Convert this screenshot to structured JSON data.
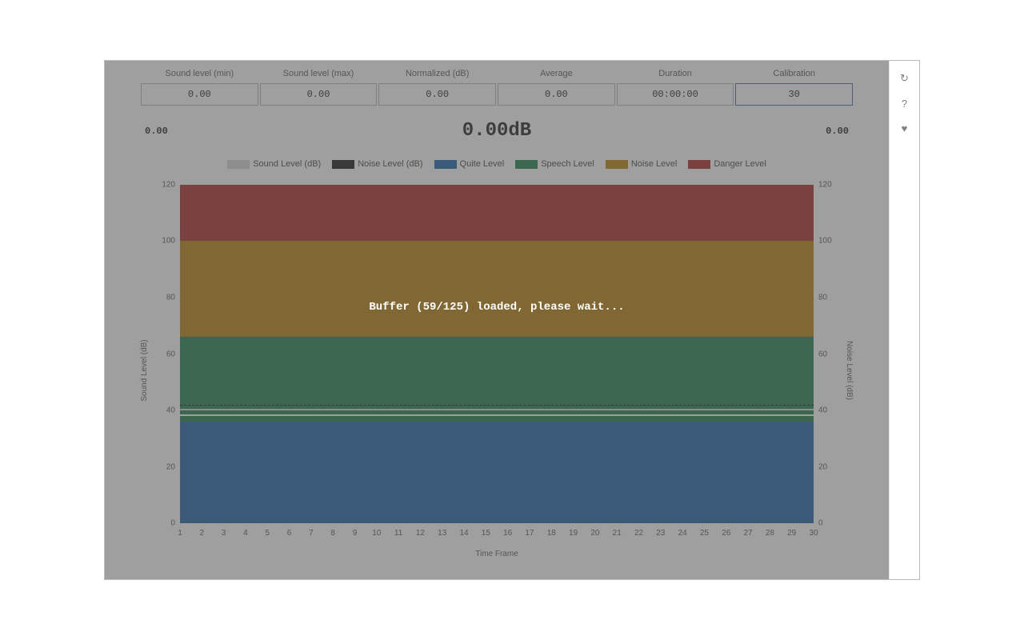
{
  "stats": {
    "min": {
      "label": "Sound level (min)",
      "value": "0.00"
    },
    "max": {
      "label": "Sound level (max)",
      "value": "0.00"
    },
    "normalized": {
      "label": "Normalized (dB)",
      "value": "0.00"
    },
    "average": {
      "label": "Average",
      "value": "0.00"
    },
    "duration": {
      "label": "Duration",
      "value": "00:00:00"
    },
    "calibration": {
      "label": "Calibration",
      "value": "30"
    }
  },
  "readings": {
    "left": "0.00",
    "center": "0.00dB",
    "right": "0.00"
  },
  "legend": {
    "sound": {
      "label": "Sound Level (dB)",
      "color": "#d9d9d9"
    },
    "noise": {
      "label": "Noise Level (dB)",
      "color": "#2a2a2a"
    },
    "quiet": {
      "label": "Quite Level",
      "color": "#2f6fb0"
    },
    "speech": {
      "label": "Speech Level",
      "color": "#2f8a5b"
    },
    "noisel": {
      "label": "Noise Level",
      "color": "#c08a1e"
    },
    "danger": {
      "label": "Danger Level",
      "color": "#b33a3a"
    }
  },
  "axes": {
    "ylabel_left": "Sound Level (dB)",
    "ylabel_right": "Noise Level (dB)",
    "xlabel": "Time Frame",
    "yticks": [
      0,
      20,
      40,
      60,
      80,
      100,
      120
    ],
    "xticks": [
      1,
      2,
      3,
      4,
      5,
      6,
      7,
      8,
      9,
      10,
      11,
      12,
      13,
      14,
      15,
      16,
      17,
      18,
      19,
      20,
      21,
      22,
      23,
      24,
      25,
      26,
      27,
      28,
      29,
      30
    ]
  },
  "overlay": {
    "message": "Buffer (59/125) loaded, please wait..."
  },
  "sidebar": {
    "refresh": "↻",
    "help": "?",
    "heart": "♥"
  },
  "chart_data": {
    "type": "area",
    "x": [
      1,
      2,
      3,
      4,
      5,
      6,
      7,
      8,
      9,
      10,
      11,
      12,
      13,
      14,
      15,
      16,
      17,
      18,
      19,
      20,
      21,
      22,
      23,
      24,
      25,
      26,
      27,
      28,
      29,
      30
    ],
    "bands": [
      {
        "name": "Quite Level",
        "from": 0,
        "to": 36,
        "color": "#2f6fb0"
      },
      {
        "name": "Speech Level",
        "from": 36,
        "to": 66,
        "color": "#2f8a5b"
      },
      {
        "name": "Noise Level",
        "from": 66,
        "to": 100,
        "color": "#c08a1e"
      },
      {
        "name": "Danger Level",
        "from": 100,
        "to": 120,
        "color": "#b33a3a"
      }
    ],
    "series": [
      {
        "name": "Sound Level (dB)",
        "style": "line-solid",
        "color": "#d9d9d9",
        "values": [
          38,
          38,
          38,
          38,
          38,
          38,
          38,
          38,
          38,
          38,
          38,
          38,
          38,
          38,
          38,
          38,
          38,
          38,
          38,
          38,
          38,
          38,
          38,
          38,
          38,
          38,
          38,
          38,
          38,
          38
        ]
      },
      {
        "name": "Noise Level (dB)",
        "style": "line-dashed",
        "color": "#2a2a2a",
        "values": [
          42,
          42,
          42,
          42,
          42,
          42,
          42,
          42,
          42,
          42,
          42,
          42,
          42,
          42,
          42,
          42,
          42,
          42,
          42,
          42,
          42,
          42,
          42,
          42,
          42,
          42,
          42,
          42,
          42,
          42
        ]
      }
    ],
    "xlabel": "Time Frame",
    "ylabel": "Sound Level (dB)",
    "ylim": [
      0,
      120
    ],
    "xlim": [
      1,
      30
    ]
  }
}
